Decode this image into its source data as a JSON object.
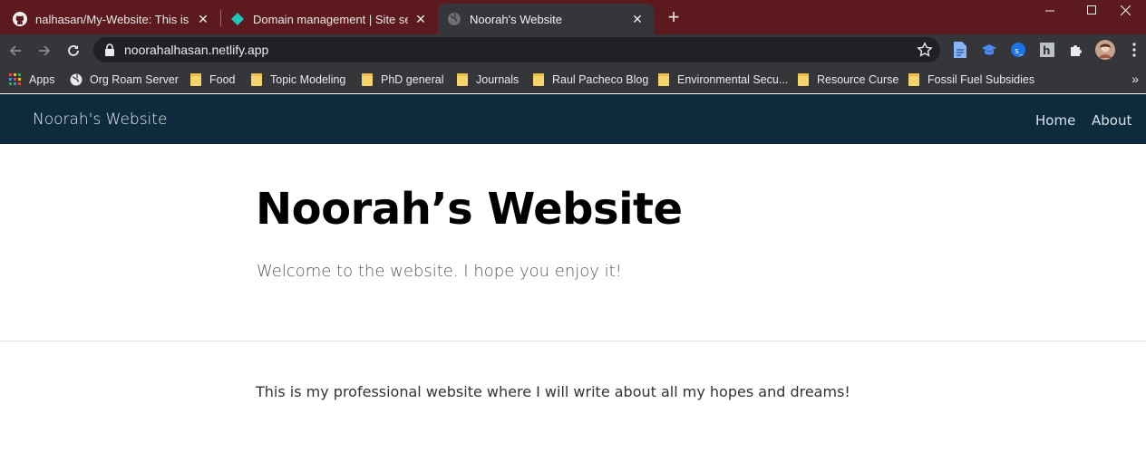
{
  "browser": {
    "tabs": [
      {
        "title": "nalhasan/My-Website: This is my",
        "icon": "github-icon",
        "active": false
      },
      {
        "title": "Domain management | Site settin",
        "icon": "netlify-icon",
        "active": false
      },
      {
        "title": "Noorah's Website",
        "icon": "globe-icon",
        "active": true
      }
    ],
    "new_tab_label": "+",
    "address": "noorahalhasan.netlify.app",
    "bookmarks_more": "»",
    "bookmarks": [
      {
        "label": "Apps",
        "icon": "apps-grid-icon"
      },
      {
        "label": "Org Roam Server",
        "icon": "globe-icon"
      },
      {
        "label": "Food",
        "icon": "folder-icon"
      },
      {
        "label": "Topic Modeling",
        "icon": "folder-icon"
      },
      {
        "label": "PhD general",
        "icon": "folder-icon"
      },
      {
        "label": "Journals",
        "icon": "folder-icon"
      },
      {
        "label": "Raul Pacheco Blog",
        "icon": "folder-icon"
      },
      {
        "label": "Environmental Secu...",
        "icon": "folder-icon"
      },
      {
        "label": "Resource Curse",
        "icon": "folder-icon"
      },
      {
        "label": "Fossil Fuel Subsidies",
        "icon": "folder-icon"
      }
    ],
    "colors": {
      "tabstrip": "#5c1a1e",
      "toolbar": "#35363a",
      "omnibox": "#202124"
    }
  },
  "site": {
    "brand": "Noorah's Website",
    "nav": {
      "home": "Home",
      "about": "About"
    },
    "hero": {
      "title": "Noorah’s Website",
      "subtitle": "Welcome to the website. I hope you enjoy it!"
    },
    "body": "This is my professional website where I will write about all my hopes and dreams!",
    "colors": {
      "navbar": "#0e2b3d"
    }
  }
}
